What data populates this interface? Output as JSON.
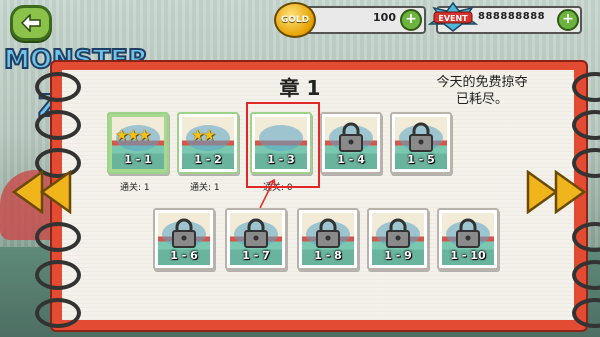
{
  "topbar": {
    "gold_label": "GOLD",
    "gold_value": "100",
    "event_label": "EVENT",
    "event_value": "888888888",
    "plus": "+"
  },
  "logo": {
    "line1": "MONSTER",
    "line2": "Z"
  },
  "chapter": {
    "title": "章 1",
    "notice_line1": "今天的免费掠夺",
    "notice_line2": "已耗尽。"
  },
  "levels_row1": [
    {
      "label": "1 - 1",
      "stars": "★★★",
      "clears": "通关: 1",
      "locked": false
    },
    {
      "label": "1 - 2",
      "stars": "★★",
      "clears": "通关: 1",
      "locked": false
    },
    {
      "label": "1 - 3",
      "stars": "",
      "clears": "通关: 0",
      "locked": false
    },
    {
      "label": "1 - 4",
      "locked": true
    },
    {
      "label": "1 - 5",
      "locked": true
    }
  ],
  "levels_row2": [
    {
      "label": "1 - 6",
      "locked": true
    },
    {
      "label": "1 - 7",
      "locked": true
    },
    {
      "label": "1 - 8",
      "locked": true
    },
    {
      "label": "1 - 9",
      "locked": true
    },
    {
      "label": "1 - 10",
      "locked": true
    }
  ],
  "colors": {
    "panel_border": "#e34b33",
    "panel_bg": "#f4f1ea",
    "star": "#f3c21a",
    "highlight": "#e02828"
  }
}
